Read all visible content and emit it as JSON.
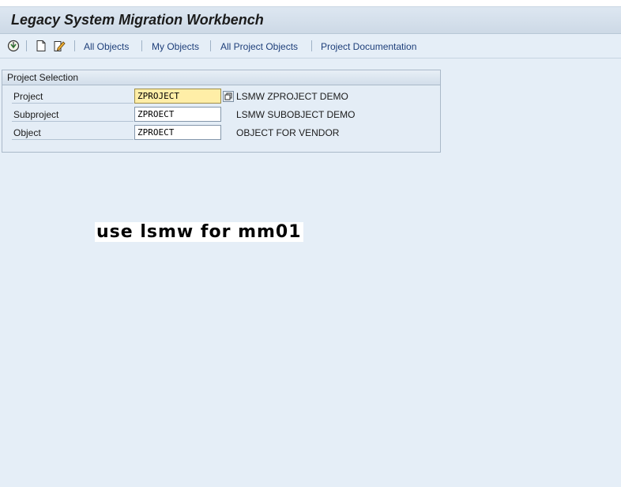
{
  "header": {
    "title": "Legacy System Migration Workbench"
  },
  "toolbar": {
    "icons": [
      "execute-icon",
      "new-document-icon",
      "edit-icon"
    ],
    "links": [
      {
        "label": "All Objects"
      },
      {
        "label": "My Objects"
      },
      {
        "label": "All Project Objects"
      },
      {
        "label": "Project Documentation"
      }
    ]
  },
  "project_selection": {
    "title": "Project Selection",
    "rows": [
      {
        "label": "Project",
        "value": "ZPROJECT",
        "description": "LSMW ZPROJECT DEMO"
      },
      {
        "label": "Subproject",
        "value": "ZPROECT",
        "description": "LSMW SUBOBJECT DEMO"
      },
      {
        "label": "Object",
        "value": "ZPROECT",
        "description": "OBJECT FOR VENDOR"
      }
    ]
  },
  "caption": "use lsmw for mm01"
}
